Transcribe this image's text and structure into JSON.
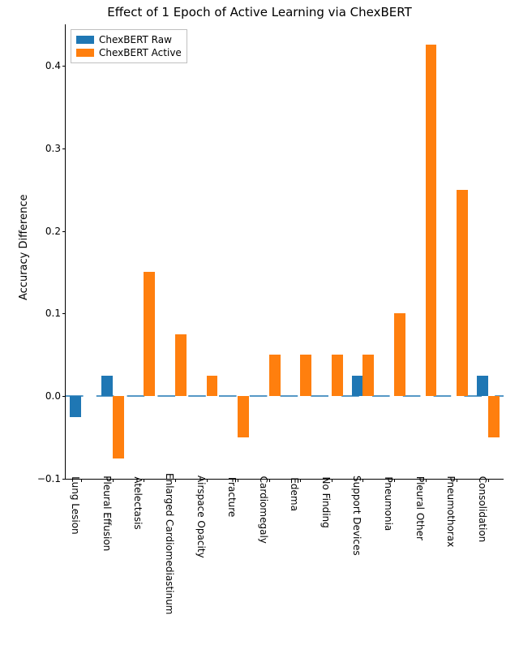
{
  "chart_data": {
    "type": "bar",
    "title": "Effect of 1 Epoch of Active Learning via ChexBERT",
    "xlabel": "",
    "ylabel": "Accuracy Difference",
    "ylim": [
      -0.1,
      0.45
    ],
    "yticks": [
      -0.1,
      0.0,
      0.1,
      0.2,
      0.3,
      0.4
    ],
    "ytick_labels": [
      "−0.1",
      "0.0",
      "0.1",
      "0.2",
      "0.3",
      "0.4"
    ],
    "categories": [
      "Lung Lesion",
      "Pleural Effusion",
      "Atelectasis",
      "Enlarged Cardiomediastinum",
      "Airspace Opacity",
      "Fracture",
      "Cardiomegaly",
      "Edema",
      "No Finding",
      "Support Devices",
      "Pneumonia",
      "Pleural Other",
      "Pneumothorax",
      "Consolidation"
    ],
    "series": [
      {
        "name": "ChexBERT Raw",
        "color": "#1f77b4",
        "values": [
          -0.025,
          0.025,
          0.0,
          0.0,
          0.0,
          0.0,
          0.0,
          0.0,
          0.0,
          0.025,
          0.0,
          0.0,
          0.0,
          0.025
        ]
      },
      {
        "name": "ChexBERT Active",
        "color": "#ff7f0e",
        "values": [
          0.0,
          -0.075,
          0.15,
          0.075,
          0.025,
          -0.05,
          0.05,
          0.05,
          0.05,
          0.05,
          0.1,
          0.425,
          0.25,
          -0.05
        ]
      }
    ],
    "zero_line_color": "#1f77b4",
    "legend_position": "upper-left"
  }
}
